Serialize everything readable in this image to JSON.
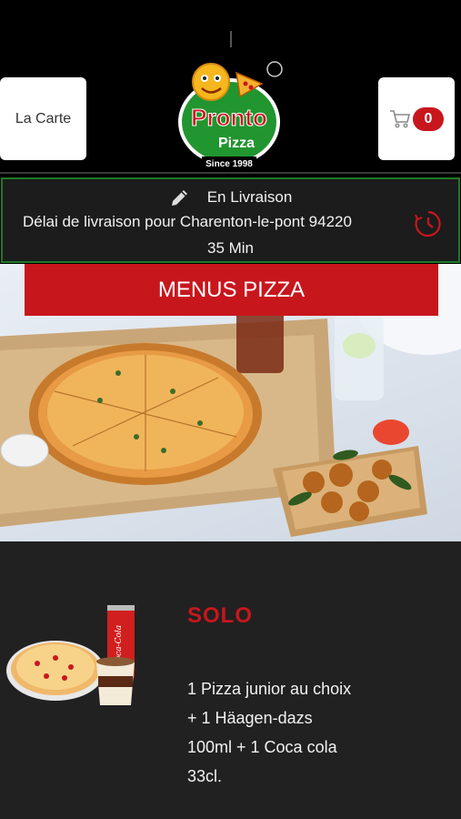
{
  "header": {
    "menu_button_label": "La Carte",
    "cart_count": "0"
  },
  "logo": {
    "brand": "Pronto",
    "sub": "Pizza",
    "since": "Since 1998"
  },
  "delivery": {
    "mode": "En Livraison",
    "delay_text": "Délai de livraison pour Charenton-le-pont 94220",
    "time": "35 Min"
  },
  "hero": {
    "banner_label": "MENUS PIZZA"
  },
  "menu_item": {
    "title": "SOLO",
    "description": "1 Pizza junior au choix  + 1 Häagen-dazs 100ml  + 1 Coca cola 33cl.",
    "can_text": "Coca-Cola"
  },
  "colors": {
    "accent_red": "#c8161d",
    "border_green": "#1c7a2a",
    "background": "#000000",
    "panel": "#212121"
  },
  "icons": [
    "pencil-icon",
    "clock-icon",
    "cart-icon"
  ]
}
